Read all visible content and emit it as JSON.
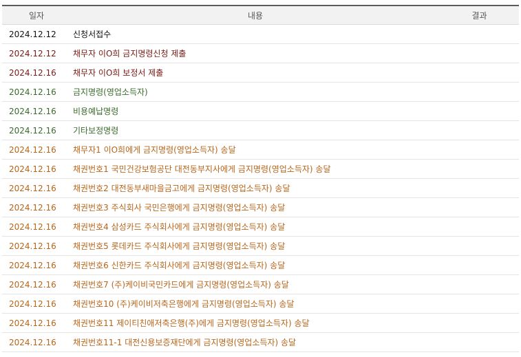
{
  "header": {
    "date": "일자",
    "content": "내용",
    "result": "결과"
  },
  "rows": [
    {
      "date": "2024.12.12",
      "content": "신청서접수",
      "result": "",
      "kind": "black"
    },
    {
      "date": "2024.12.12",
      "content": "채무자 이O희 금지명령신청 제출",
      "result": "",
      "kind": "maroon"
    },
    {
      "date": "2024.12.16",
      "content": "채무자 이O희 보정서 제출",
      "result": "",
      "kind": "maroon"
    },
    {
      "date": "2024.12.16",
      "content": "금지명령(영업소득자)",
      "result": "",
      "kind": "green"
    },
    {
      "date": "2024.12.16",
      "content": "비용예납명령",
      "result": "",
      "kind": "green"
    },
    {
      "date": "2024.12.16",
      "content": "기타보정명령",
      "result": "",
      "kind": "green"
    },
    {
      "date": "2024.12.16",
      "content": "채무자1 이O희에게 금지명령(영업소득자) 송달",
      "result": "",
      "kind": "orange"
    },
    {
      "date": "2024.12.16",
      "content": "채권번호1 국민건강보험공단 대전동부지사에게 금지명령(영업소득자) 송달",
      "result": "",
      "kind": "orange"
    },
    {
      "date": "2024.12.16",
      "content": "채권번호2 대전동부새마을금고에게 금지명령(영업소득자) 송달",
      "result": "",
      "kind": "orange"
    },
    {
      "date": "2024.12.16",
      "content": "채권번호3 주식회사 국민은행에게 금지명령(영업소득자) 송달",
      "result": "",
      "kind": "orange"
    },
    {
      "date": "2024.12.16",
      "content": "채권번호4 삼성카드 주식회사에게 금지명령(영업소득자) 송달",
      "result": "",
      "kind": "orange"
    },
    {
      "date": "2024.12.16",
      "content": "채권번호5 롯데카드 주식회사에게 금지명령(영업소득자) 송달",
      "result": "",
      "kind": "orange"
    },
    {
      "date": "2024.12.16",
      "content": "채권번호6 신한카드 주식회사에게 금지명령(영업소득자) 송달",
      "result": "",
      "kind": "orange"
    },
    {
      "date": "2024.12.16",
      "content": "채권번호7 (주)케이비국민카드에게 금지명령(영업소득자) 송달",
      "result": "",
      "kind": "orange"
    },
    {
      "date": "2024.12.16",
      "content": "채권번호10 (주)케이비저축은행에게 금지명령(영업소득자) 송달",
      "result": "",
      "kind": "orange"
    },
    {
      "date": "2024.12.16",
      "content": "채권번호11 제이티친애저축은행(주)에게 금지명령(영업소득자) 송달",
      "result": "",
      "kind": "orange"
    },
    {
      "date": "2024.12.16",
      "content": "채권번호11-1 대전신용보증재단에게 금지명령(영업소득자) 송달",
      "result": "",
      "kind": "orange"
    }
  ],
  "colors": {
    "black": "#111111",
    "maroon": "#7a1a14",
    "green": "#3b6b2c",
    "orange": "#b8651a",
    "header_bg": "#f2f2f2"
  }
}
